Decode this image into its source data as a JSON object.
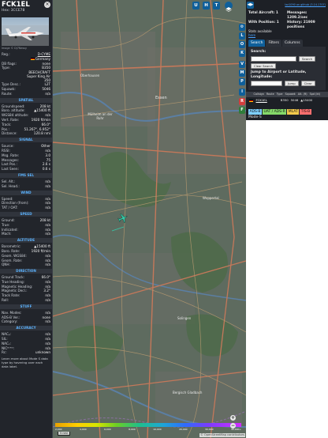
{
  "left": {
    "callsign": "FCK1EL",
    "hex_line": "Hex: 3CCE78",
    "close_label": "×",
    "photo_credit": "Image © Dj7Nessy",
    "reg_label": "Reg.:",
    "reg_value": "D-CYME",
    "country": "Germany",
    "dbflags_label": "DB flags:",
    "dbflags_value": "none",
    "type_label": "Type:",
    "type_value": "B350",
    "type_desc_long": "BEECHCRAFT Super King Air 350",
    "typedesc_label": "Type Desc.:",
    "typedesc_value": "L2T",
    "squawk_label": "Squawk:",
    "squawk_value": "5046",
    "route_label": "Route:",
    "route_value": "n/a",
    "sections": {
      "spatial": "SPATIAL",
      "signal": "SIGNAL",
      "fmssel": "FMS SEL",
      "wind": "WIND",
      "speed": "SPEED",
      "altitude": "ALTITUDE",
      "direction": "DIRECTION",
      "stuff": "STUFF",
      "accuracy": "ACCURACY"
    },
    "spatial": [
      {
        "k": "Groundspeed:",
        "v": "208 kt"
      },
      {
        "k": "Baro. altitude:",
        "v": "▲15400 ft"
      },
      {
        "k": "WGS84 altitude:",
        "v": "n/a"
      },
      {
        "k": "Vert. Rate:",
        "v": "1920 ft/min"
      },
      {
        "k": "Track:",
        "v": "66.0°"
      },
      {
        "k": "Pos.:",
        "v": "51.267°, 6.952°"
      },
      {
        "k": "Distance:",
        "v": "120.8 nmi"
      }
    ],
    "signal": [
      {
        "k": "Source:",
        "v": "Other"
      },
      {
        "k": "RSSI:",
        "v": "n/a"
      },
      {
        "k": "Msg. Rate:",
        "v": "3.0"
      },
      {
        "k": "Messages:",
        "v": "75"
      },
      {
        "k": "Last Pos.:",
        "v": "2.6 s"
      },
      {
        "k": "Last Seen:",
        "v": "0.6 s"
      }
    ],
    "fmssel": [
      {
        "k": "Sel. Alt.:",
        "v": "n/a"
      },
      {
        "k": "Sel. Head.:",
        "v": "n/a"
      }
    ],
    "wind": [
      {
        "k": "Speed:",
        "v": "n/a"
      },
      {
        "k": "Direction (from):",
        "v": "n/a"
      },
      {
        "k": "TAT / OAT:",
        "v": "n/a"
      }
    ],
    "speed": [
      {
        "k": "Ground:",
        "v": "208 kt"
      },
      {
        "k": "True:",
        "v": "n/a"
      },
      {
        "k": "Indicated:",
        "v": "n/a"
      },
      {
        "k": "Mach:",
        "v": "n/a"
      }
    ],
    "altitude": [
      {
        "k": "Barometric:",
        "v": "▲15400 ft"
      },
      {
        "k": "Baro. Rate:",
        "v": "1920 ft/min"
      },
      {
        "k": "Geom. WGS84:",
        "v": "n/a"
      },
      {
        "k": "Geom. Rate:",
        "v": "n/a"
      },
      {
        "k": "QNH:",
        "v": "n/a"
      }
    ],
    "direction": [
      {
        "k": "Ground Track:",
        "v": "66.0°"
      },
      {
        "k": "True Heading:",
        "v": "n/a"
      },
      {
        "k": "Magnetic Heading:",
        "v": "n/a"
      },
      {
        "k": "Magnetic Decl.:",
        "v": "3.2°"
      },
      {
        "k": "Track Rate:",
        "v": "n/a"
      },
      {
        "k": "Roll:",
        "v": "n/a"
      }
    ],
    "stuff": [
      {
        "k": "Nav. Modes:",
        "v": "n/a"
      },
      {
        "k": "ADS-B Ver.:",
        "v": "none"
      },
      {
        "k": "Category:",
        "v": "n/a"
      }
    ],
    "accuracy": [
      {
        "k": "NACₚ:",
        "v": "n/a"
      },
      {
        "k": "SIL:",
        "v": "n/a"
      },
      {
        "k": "NACᵥ:",
        "v": "n/a"
      },
      {
        "k": "NICᴮᴬᴿᴼ:",
        "v": "n/a"
      },
      {
        "k": "Rᴄ:",
        "v": "unknown"
      }
    ],
    "note": "Learn more about Mode S data type by hovering over each data label."
  },
  "map": {
    "top_buttons": [
      "U",
      "H",
      "T"
    ],
    "side_buttons": [
      "L",
      "O",
      "K",
      "V",
      "M",
      "P",
      "I",
      "R",
      "F"
    ],
    "zoom_in": "+",
    "zoom_out": "−",
    "scale_label": "5 nmi",
    "attribution": "© OpenStreetMap contributors",
    "alt_ticks": [
      "2,000",
      "4,000",
      "6,000",
      "8,000",
      "10,000",
      "20,000",
      "30,000",
      "40,000+"
    ],
    "place_labels": [
      {
        "name": "Oberhausen"
      },
      {
        "name": "Mülheim an der Ruhr"
      },
      {
        "name": "Essen"
      },
      {
        "name": "Wuppertal"
      },
      {
        "name": "Solingen"
      },
      {
        "name": "Bergisch Gladbach"
      }
    ]
  },
  "right": {
    "arrow_label": "◀▶",
    "version_link": "tar1090 on github (3.14.1707)",
    "total_aircraft": "Total Aircraft: 1",
    "messages": "Messages: 1209.2/sec",
    "with_position": "With Position: 1",
    "history": "History: 21909 positions",
    "stats_available": "Stats available",
    "stats_link": "here",
    "tabs": [
      "Search",
      "Filters",
      "Columns"
    ],
    "search_label": "Search:",
    "search_button": "Search",
    "clear_search": "Clear Search",
    "jump_label": "Jump to Airport or Latitude, Longitude:",
    "jump_button": "Jump",
    "clear_button": "Clear",
    "columns": [
      "Callsign",
      "Route",
      "Type",
      "Squawk",
      "Alt. (ft)",
      "Spd (kt)"
    ],
    "row": {
      "callsign": "FCK1EL",
      "type": "B350",
      "squawk": "5046",
      "alt": "▲15400"
    },
    "legend": [
      {
        "label": "ADS-B",
        "color": "#7fd0ff"
      },
      {
        "label": "UAT / ADS-R",
        "color": "#85d96a"
      },
      {
        "label": "MLAT",
        "color": "#f2c94c"
      },
      {
        "label": "TIS-B",
        "color": "#ff6f6f"
      }
    ],
    "modes_label": "Mode-S"
  },
  "colors": {
    "accent": "#0f5f9a",
    "link": "#4aa3ff",
    "section_header": "#5bb3ff",
    "aircraft": "#36c9a8"
  }
}
